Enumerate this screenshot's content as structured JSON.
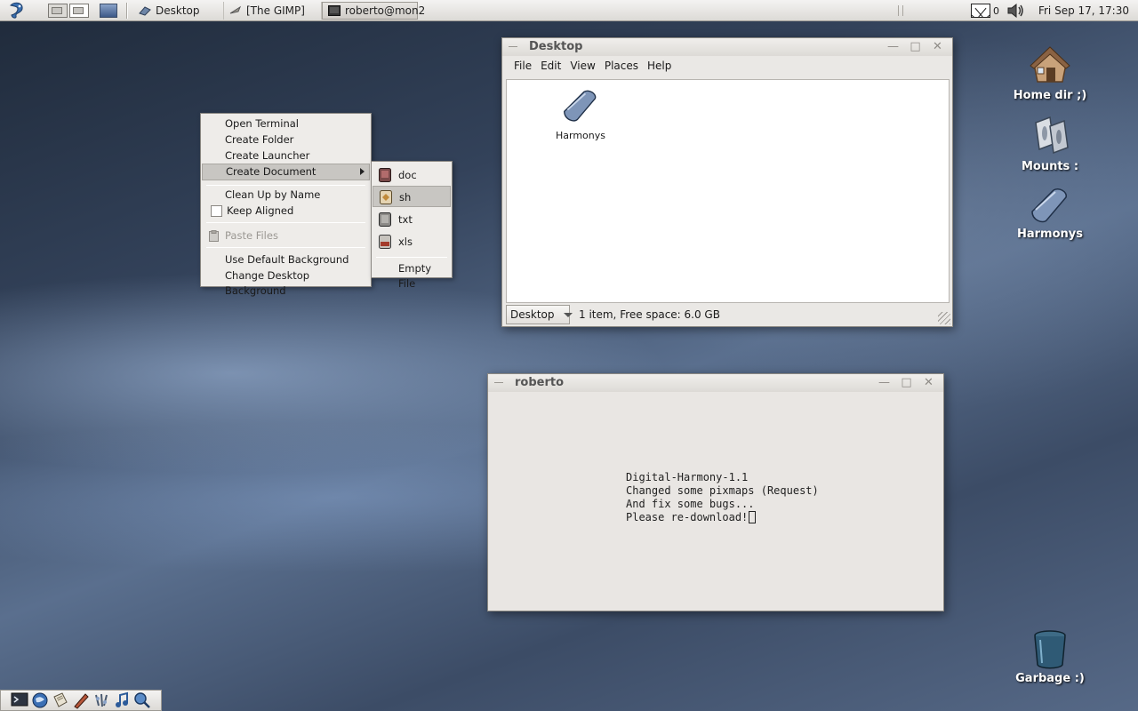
{
  "panel": {
    "tasks": [
      {
        "label": "Desktop"
      },
      {
        "label": "[The GIMP]"
      },
      {
        "label": "roberto@mon2"
      }
    ],
    "mail_count": "0",
    "clock": "Fri Sep 17, 17:30"
  },
  "desktop_icons": [
    {
      "label": "Home dir ;)"
    },
    {
      "label": "Mounts :"
    },
    {
      "label": "Harmonys"
    },
    {
      "label": "Garbage :)"
    }
  ],
  "file_manager": {
    "title": "Desktop",
    "menu": [
      "File",
      "Edit",
      "View",
      "Places",
      "Help"
    ],
    "items": [
      {
        "label": "Harmonys"
      }
    ],
    "location_combo": "Desktop",
    "status": "1 item, Free space: 6.0 GB"
  },
  "terminal": {
    "title": "roberto",
    "lines": [
      "Digital-Harmony-1.1",
      "Changed some pixmaps (Request)",
      "And fix some bugs...",
      "Please re-download!"
    ]
  },
  "context_menu": {
    "items": [
      {
        "label": "Open Terminal"
      },
      {
        "label": "Create Folder"
      },
      {
        "label": "Create Launcher"
      },
      {
        "label": "Create Document"
      },
      {
        "label": "Clean Up by Name"
      },
      {
        "label": "Keep Aligned"
      },
      {
        "label": "Paste Files"
      },
      {
        "label": "Use Default Background"
      },
      {
        "label": "Change Desktop Background"
      }
    ]
  },
  "submenu": {
    "items": [
      {
        "label": "doc",
        "icon": "doc-file-icon"
      },
      {
        "label": "sh",
        "icon": "sh-file-icon"
      },
      {
        "label": "txt",
        "icon": "txt-file-icon"
      },
      {
        "label": "xls",
        "icon": "xls-file-icon"
      }
    ],
    "empty_file": "Empty File"
  },
  "launcher": {
    "icons": [
      "terminal-icon",
      "browser-icon",
      "text-editor-icon",
      "pen-icon",
      "mixer-icon",
      "music-icon",
      "search-icon"
    ]
  },
  "colors": {
    "menu_highlight": "#c8c6c2",
    "panel_bg": "#dcdad6"
  }
}
